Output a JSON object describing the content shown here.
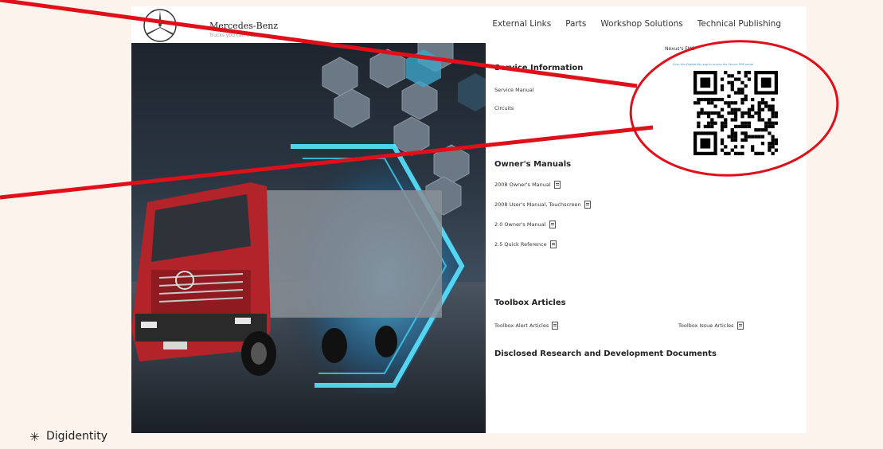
{
  "header": {
    "brand": "Mercedes-Benz",
    "brand_sub": "Trucks you can trust",
    "nav": [
      "External Links",
      "Parts",
      "Workshop Solutions",
      "Technical Publishing"
    ]
  },
  "service_info": {
    "title": "Service Information",
    "links": [
      "Service Manual",
      "Circuits"
    ]
  },
  "qr_box": {
    "label": "Nexus's FMS",
    "caption": "Scan this Digidentity app to access the Secure FMS portal"
  },
  "owners_manuals": {
    "title": "Owner's Manuals",
    "links": [
      "2008 Owner's Manual",
      "2008 User's Manual, Touchscreen",
      "2.0 Owner's Manual",
      "2.5 Quick Reference"
    ]
  },
  "toolbox": {
    "title": "Toolbox Articles",
    "links": [
      "Toolbox Alert Articles",
      "Toolbox Issue Articles"
    ]
  },
  "disclosed": {
    "title": "Disclosed Research and Development Documents"
  },
  "footer": {
    "brand": "Digidentity",
    "icon": "asterisk-icon"
  },
  "colors": {
    "annotation": "#e0101a",
    "accent_glow": "#3fd6f5",
    "truck": "#b3232a"
  },
  "icons": [
    "mercedes-star-icon",
    "pdf-icon",
    "qr-code-icon",
    "asterisk-icon"
  ]
}
